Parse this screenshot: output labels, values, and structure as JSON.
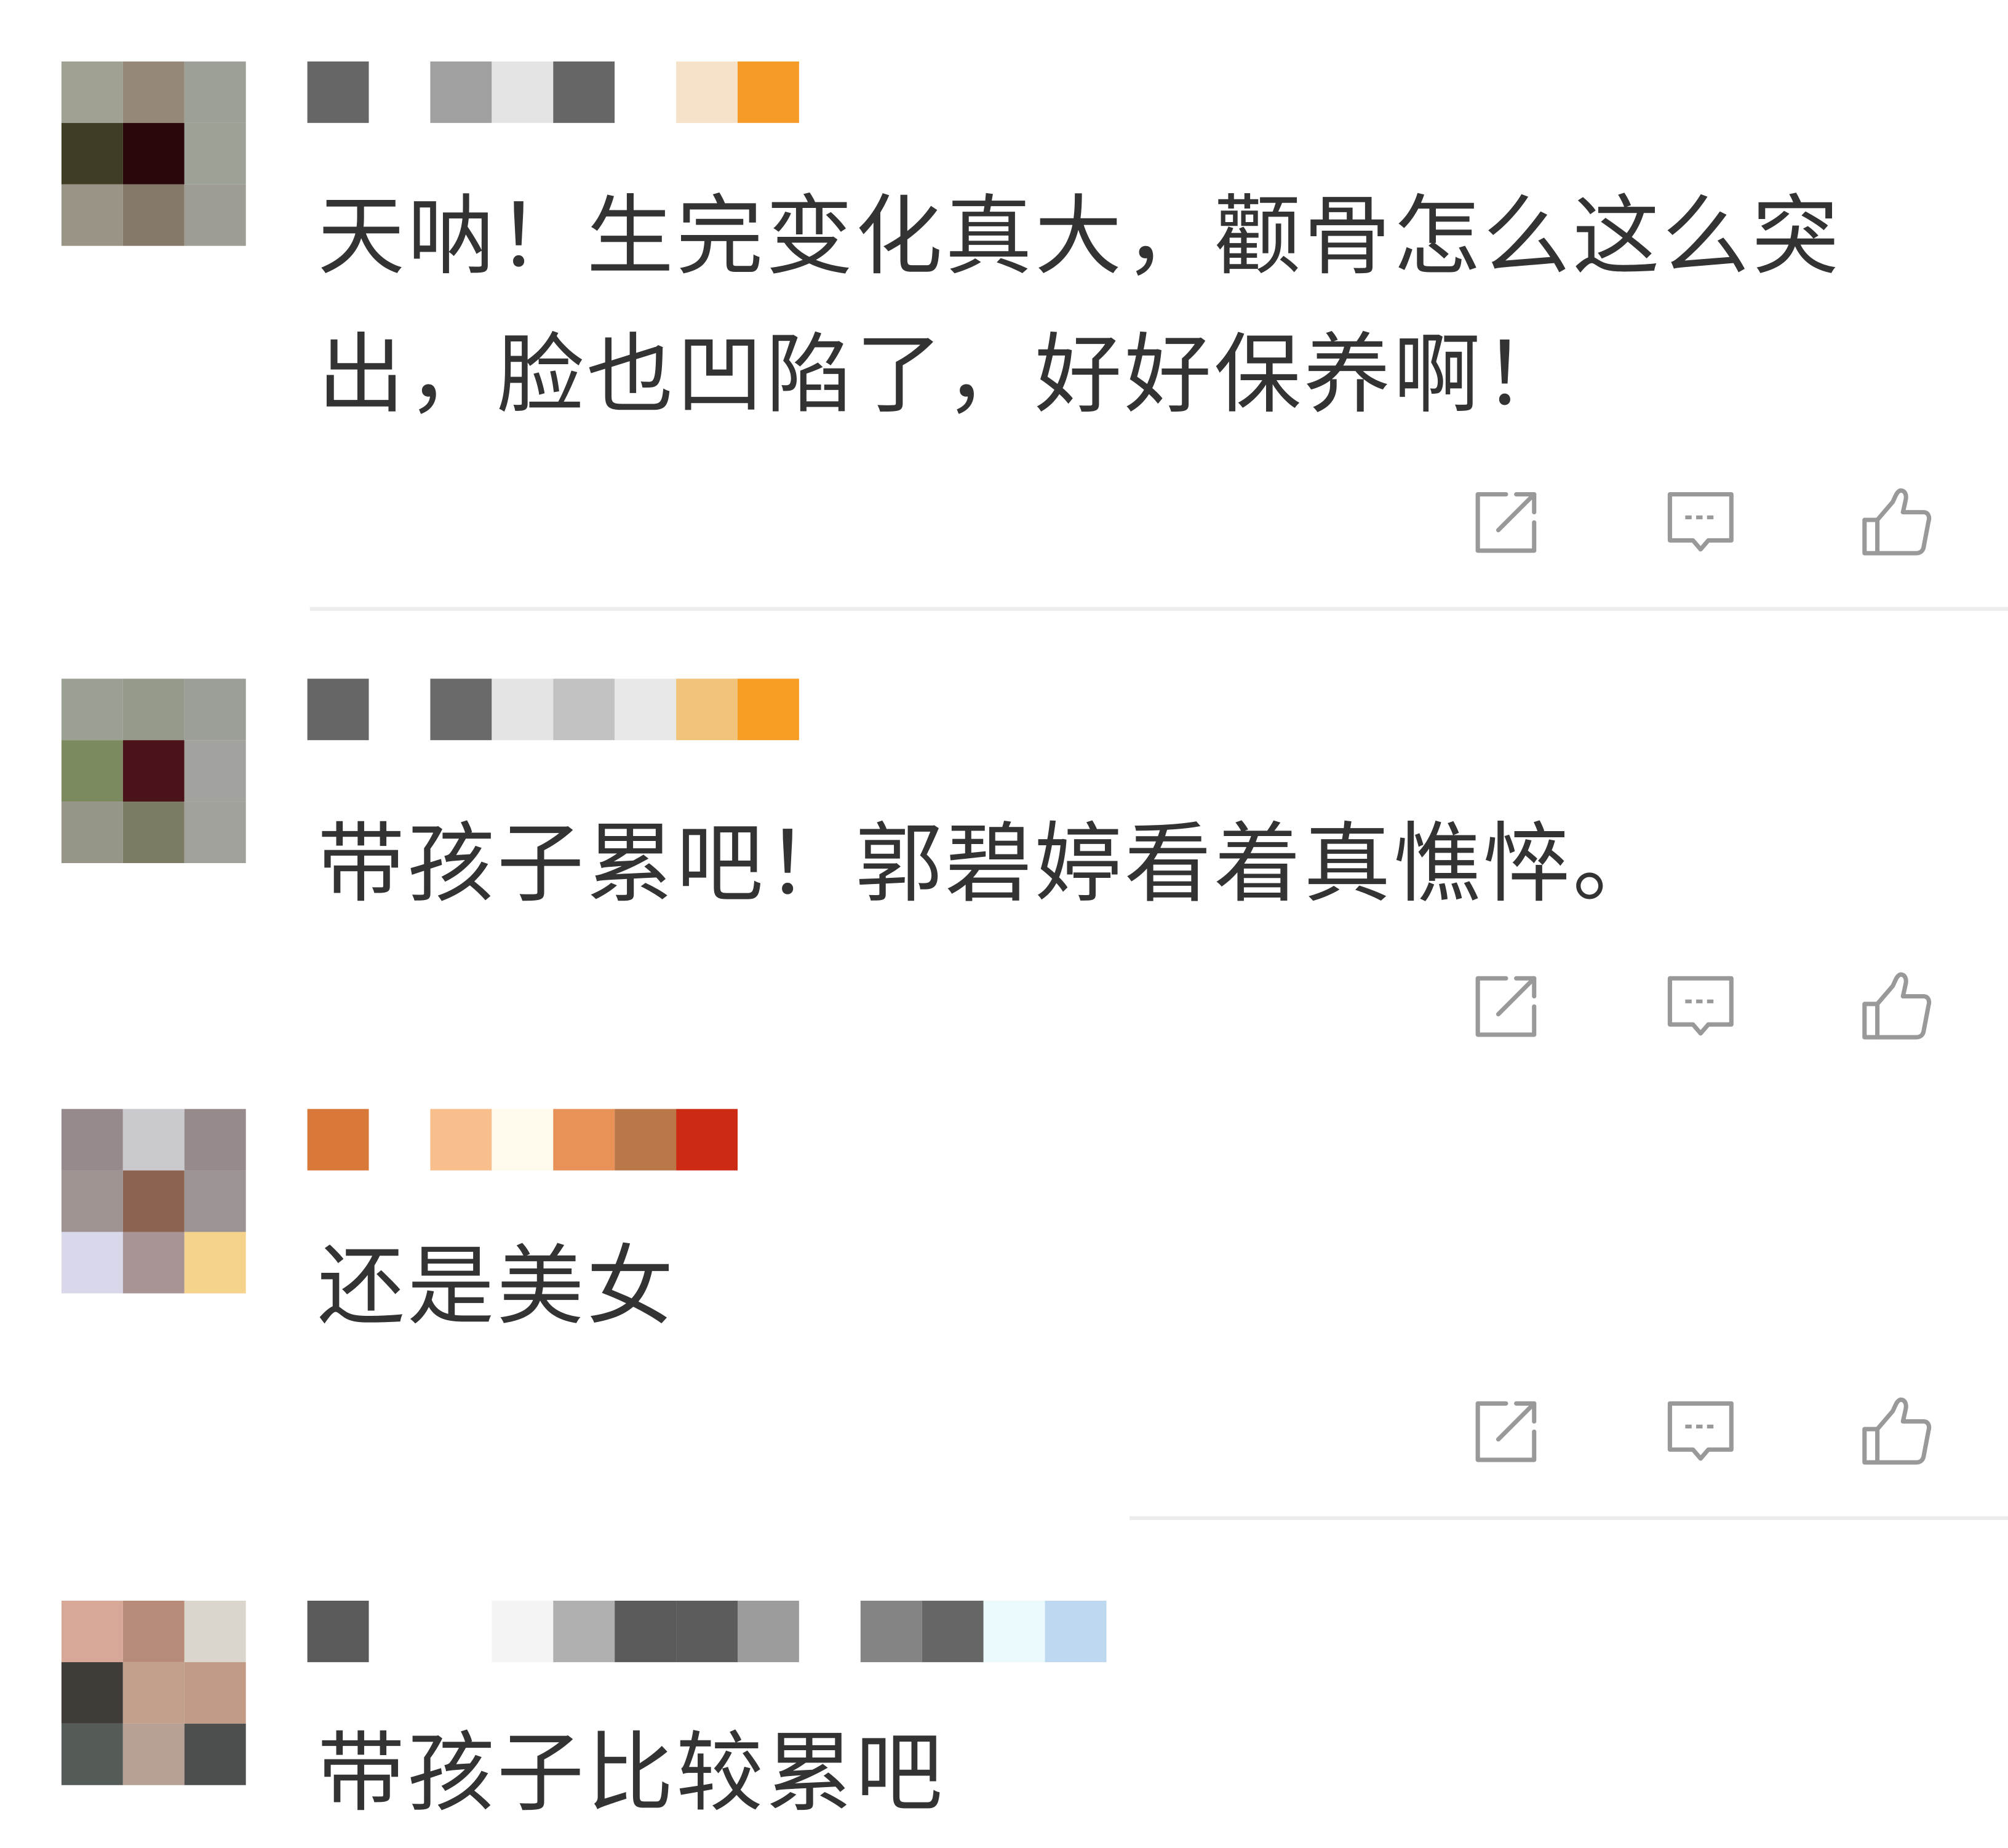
{
  "comments": [
    {
      "avatar_colors": [
        "#a0a093",
        "#968878",
        "#9ca096",
        "#3f3e24",
        "#29070b",
        "#9da297",
        "#9a9486",
        "#857a6a",
        "#9d9d95"
      ],
      "name_colors": [
        "#666666",
        "#ffffff",
        "#a0a0a0",
        "#e4e4e4",
        "#666666",
        "#ffffff",
        "#f5e2c8",
        "#f79b28"
      ],
      "text": "天呐！生完变化真大，颧骨怎么这么突出，脸也凹陷了，好好保养啊！",
      "meta_colors": [
        "#ffffff",
        "#a6a6a6",
        "#b6b6b6"
      ],
      "actions": {
        "share": "share-icon",
        "reply": "comment-icon",
        "like": "thumbs-up-icon"
      }
    },
    {
      "avatar_colors": [
        "#9ba094",
        "#94998a",
        "#9c9e98",
        "#7b8b5f",
        "#4a1319",
        "#a2a39e",
        "#979488",
        "#7c7b64",
        "#a0a19a"
      ],
      "name_colors": [
        "#666666",
        "#ffffff",
        "#6a6a6a",
        "#e4e4e4",
        "#c2c2c2",
        "#e8e8e8",
        "#f0c27a",
        "#f89d24"
      ],
      "text": "带孩子累吧！郭碧婷看着真憔悴。",
      "meta_colors": [],
      "actions": {
        "share": "share-icon",
        "reply": "comment-icon",
        "like": "thumbs-up-icon"
      }
    },
    {
      "avatar_colors": [
        "#968a8d",
        "#cac9ce",
        "#968a8b",
        "#9d9492",
        "#8b6350",
        "#9c9494",
        "#d8d8ea",
        "#a89495",
        "#f5d38c"
      ],
      "name_colors": [
        "#d97939",
        "#ffffff",
        "#f8be8b",
        "#fffaec",
        "#e89257",
        "#ba7747",
        "#cc2a12"
      ],
      "text": "还是美女",
      "meta_colors": [
        "#e0e0e0",
        "#ffffff",
        "#a8a8a8",
        "#c4c4c4",
        "#ececec",
        "#aaaaaa"
      ],
      "actions": {
        "share": "share-icon",
        "reply": "comment-icon",
        "like": "thumbs-up-icon"
      }
    },
    {
      "avatar_colors": [
        "#d7a898",
        "#b88a78",
        "#dad6cb",
        "#403c38",
        "#c2a08c",
        "#c29b86",
        "#555c58",
        "#b7a196",
        "#4d4f4e"
      ],
      "name_colors": [
        "#5a5a5a",
        "#ffffff",
        "#ffffff",
        "#f4f4f4",
        "#b0b0b0",
        "#5a5a5a",
        "#5c5c5c",
        "#9c9c9c",
        "#ffffff",
        "#848484",
        "#666666",
        "#ebfafc",
        "#bed8f0"
      ],
      "text": "带孩子比较累吧"
    }
  ],
  "icon_color": "#999999"
}
